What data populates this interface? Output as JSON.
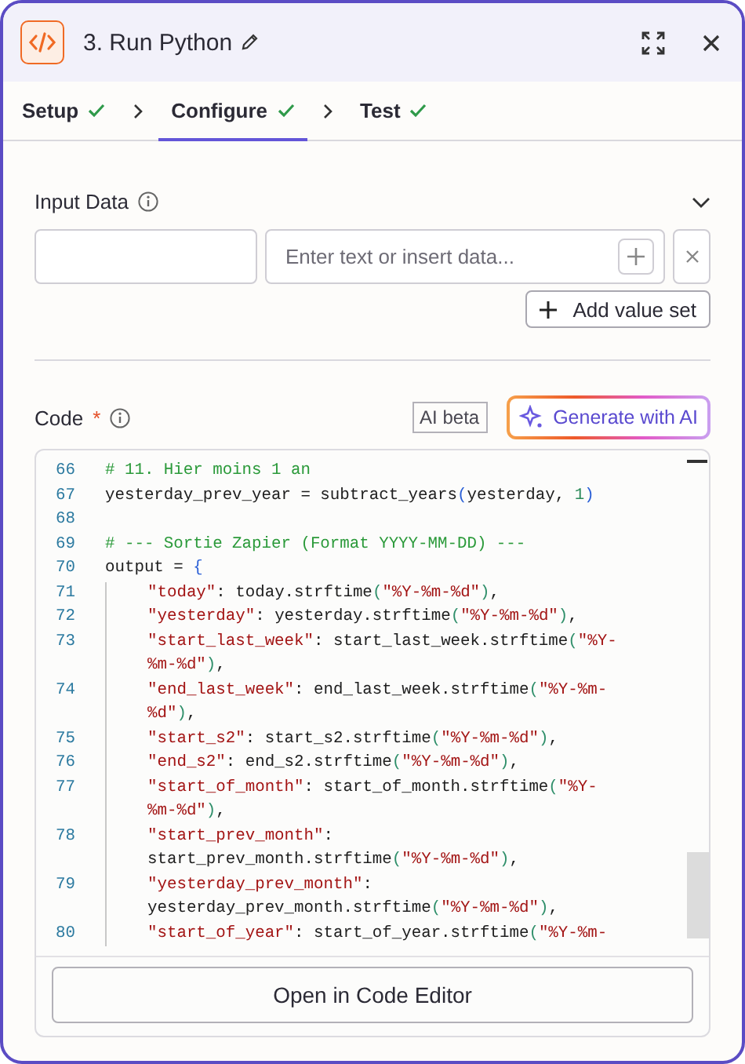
{
  "header": {
    "title": "3. Run Python"
  },
  "steps": [
    {
      "label": "Setup",
      "done": true,
      "selected": false
    },
    {
      "label": "Configure",
      "done": true,
      "selected": true
    },
    {
      "label": "Test",
      "done": true,
      "selected": false
    }
  ],
  "input_data": {
    "label": "Input Data",
    "expanded": true,
    "value_placeholder": "Enter text or insert data...",
    "add_button": "Add value set"
  },
  "code": {
    "label": "Code",
    "required_mark": "*",
    "badge": "AI beta",
    "generate_button": "Generate with AI",
    "open_button": "Open in Code Editor",
    "lines": [
      {
        "number": "66",
        "indented": false,
        "rows": [
          {
            "tokens": [
              {
                "kind": "comment",
                "text": "# 11. Hier moins 1 an"
              }
            ]
          }
        ]
      },
      {
        "number": "67",
        "indented": false,
        "rows": [
          {
            "tokens": [
              {
                "kind": "plain",
                "text": "yesterday_prev_year = subtract_years"
              },
              {
                "kind": "bracket",
                "text": "("
              },
              {
                "kind": "plain",
                "text": "yesterday, "
              },
              {
                "kind": "number",
                "text": "1"
              },
              {
                "kind": "bracket",
                "text": ")"
              }
            ]
          }
        ]
      },
      {
        "number": "68",
        "indented": false,
        "rows": [
          {
            "tokens": []
          }
        ]
      },
      {
        "number": "69",
        "indented": false,
        "rows": [
          {
            "tokens": [
              {
                "kind": "comment",
                "text": "# --- Sortie Zapier (Format YYYY-MM-DD) ---"
              }
            ]
          }
        ]
      },
      {
        "number": "70",
        "indented": false,
        "rows": [
          {
            "tokens": [
              {
                "kind": "plain",
                "text": "output = "
              },
              {
                "kind": "bracket",
                "text": "{"
              }
            ]
          }
        ]
      },
      {
        "number": "71",
        "indented": true,
        "rows": [
          {
            "tokens": [
              {
                "kind": "string",
                "text": "\"today\""
              },
              {
                "kind": "plain",
                "text": ": today.strftime"
              },
              {
                "kind": "paren",
                "text": "("
              },
              {
                "kind": "string",
                "text": "\"%Y-%m-%d\""
              },
              {
                "kind": "paren",
                "text": ")"
              },
              {
                "kind": "plain",
                "text": ","
              }
            ]
          }
        ]
      },
      {
        "number": "72",
        "indented": true,
        "rows": [
          {
            "tokens": [
              {
                "kind": "string",
                "text": "\"yesterday\""
              },
              {
                "kind": "plain",
                "text": ": yesterday.strftime"
              },
              {
                "kind": "paren",
                "text": "("
              },
              {
                "kind": "string",
                "text": "\"%Y-%m-%d\""
              },
              {
                "kind": "paren",
                "text": ")"
              },
              {
                "kind": "plain",
                "text": ","
              }
            ]
          }
        ]
      },
      {
        "number": "73",
        "indented": true,
        "rows": [
          {
            "tokens": [
              {
                "kind": "string",
                "text": "\"start_last_week\""
              },
              {
                "kind": "plain",
                "text": ": start_last_week.strftime"
              },
              {
                "kind": "paren",
                "text": "("
              },
              {
                "kind": "string",
                "text": "\"%Y-"
              }
            ]
          },
          {
            "tokens": [
              {
                "kind": "string",
                "text": "%m-%d\""
              },
              {
                "kind": "paren",
                "text": ")"
              },
              {
                "kind": "plain",
                "text": ","
              }
            ]
          }
        ]
      },
      {
        "number": "74",
        "indented": true,
        "rows": [
          {
            "tokens": [
              {
                "kind": "string",
                "text": "\"end_last_week\""
              },
              {
                "kind": "plain",
                "text": ": end_last_week.strftime"
              },
              {
                "kind": "paren",
                "text": "("
              },
              {
                "kind": "string",
                "text": "\"%Y-%m-"
              }
            ]
          },
          {
            "tokens": [
              {
                "kind": "string",
                "text": "%d\""
              },
              {
                "kind": "paren",
                "text": ")"
              },
              {
                "kind": "plain",
                "text": ","
              }
            ]
          }
        ]
      },
      {
        "number": "75",
        "indented": true,
        "rows": [
          {
            "tokens": [
              {
                "kind": "string",
                "text": "\"start_s2\""
              },
              {
                "kind": "plain",
                "text": ": start_s2.strftime"
              },
              {
                "kind": "paren",
                "text": "("
              },
              {
                "kind": "string",
                "text": "\"%Y-%m-%d\""
              },
              {
                "kind": "paren",
                "text": ")"
              },
              {
                "kind": "plain",
                "text": ","
              }
            ]
          }
        ]
      },
      {
        "number": "76",
        "indented": true,
        "rows": [
          {
            "tokens": [
              {
                "kind": "string",
                "text": "\"end_s2\""
              },
              {
                "kind": "plain",
                "text": ": end_s2.strftime"
              },
              {
                "kind": "paren",
                "text": "("
              },
              {
                "kind": "string",
                "text": "\"%Y-%m-%d\""
              },
              {
                "kind": "paren",
                "text": ")"
              },
              {
                "kind": "plain",
                "text": ","
              }
            ]
          }
        ]
      },
      {
        "number": "77",
        "indented": true,
        "rows": [
          {
            "tokens": [
              {
                "kind": "string",
                "text": "\"start_of_month\""
              },
              {
                "kind": "plain",
                "text": ": start_of_month.strftime"
              },
              {
                "kind": "paren",
                "text": "("
              },
              {
                "kind": "string",
                "text": "\"%Y-"
              }
            ]
          },
          {
            "tokens": [
              {
                "kind": "string",
                "text": "%m-%d\""
              },
              {
                "kind": "paren",
                "text": ")"
              },
              {
                "kind": "plain",
                "text": ","
              }
            ]
          }
        ]
      },
      {
        "number": "78",
        "indented": true,
        "rows": [
          {
            "tokens": [
              {
                "kind": "string",
                "text": "\"start_prev_month\""
              },
              {
                "kind": "plain",
                "text": ":"
              }
            ]
          },
          {
            "tokens": [
              {
                "kind": "plain",
                "text": "start_prev_month.strftime"
              },
              {
                "kind": "paren",
                "text": "("
              },
              {
                "kind": "string",
                "text": "\"%Y-%m-%d\""
              },
              {
                "kind": "paren",
                "text": ")"
              },
              {
                "kind": "plain",
                "text": ","
              }
            ]
          }
        ]
      },
      {
        "number": "79",
        "indented": true,
        "rows": [
          {
            "tokens": [
              {
                "kind": "string",
                "text": "\"yesterday_prev_month\""
              },
              {
                "kind": "plain",
                "text": ":"
              }
            ]
          },
          {
            "tokens": [
              {
                "kind": "plain",
                "text": "yesterday_prev_month.strftime"
              },
              {
                "kind": "paren",
                "text": "("
              },
              {
                "kind": "string",
                "text": "\"%Y-%m-%d\""
              },
              {
                "kind": "paren",
                "text": ")"
              },
              {
                "kind": "plain",
                "text": ","
              }
            ]
          }
        ]
      },
      {
        "number": "80",
        "indented": true,
        "rows": [
          {
            "tokens": [
              {
                "kind": "string",
                "text": "\"start_of_year\""
              },
              {
                "kind": "plain",
                "text": ": start_of_year.strftime"
              },
              {
                "kind": "paren",
                "text": "("
              },
              {
                "kind": "string",
                "text": "\"%Y-%m-"
              }
            ]
          }
        ]
      }
    ]
  }
}
